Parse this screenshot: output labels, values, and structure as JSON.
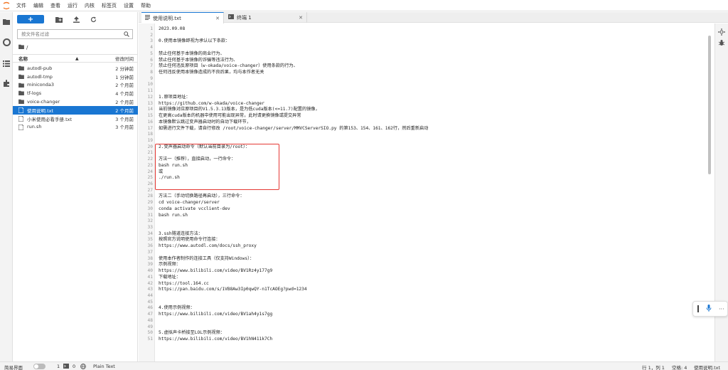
{
  "menu": [
    "文件",
    "编辑",
    "查看",
    "运行",
    "内核",
    "标签页",
    "设置",
    "帮助"
  ],
  "filebrowser": {
    "search_placeholder": "按文件名过滤",
    "breadcrumb": "/",
    "col_name": "名称",
    "col_modified": "修改时间",
    "items": [
      {
        "name": "autodl-pub",
        "time": "2 分钟前",
        "type": "folder"
      },
      {
        "name": "autodl-tmp",
        "time": "1 分钟前",
        "type": "folder"
      },
      {
        "name": "miniconda3",
        "time": "2 个月前",
        "type": "folder"
      },
      {
        "name": "tf-logs",
        "time": "4 个月前",
        "type": "folder"
      },
      {
        "name": "voice-changer",
        "time": "2 个月前",
        "type": "folder"
      },
      {
        "name": "使用说明.txt",
        "time": "2 个月前",
        "type": "file"
      },
      {
        "name": "小米使用必看手册.txt",
        "time": "3 个月前",
        "type": "file"
      },
      {
        "name": "run.sh",
        "time": "3 个月前",
        "type": "file"
      }
    ]
  },
  "tabs": [
    {
      "label": "使用说明.txt",
      "active": true
    },
    {
      "label": "终端 1",
      "active": false
    }
  ],
  "editor_lines": [
    "2023.09.08",
    "",
    "0.使用本镜像即视为承认以下条款：",
    "",
    "禁止任何基于本镜像的商业行为、",
    "禁止任何基于本镜像的诈骗等违法行为、",
    "禁止任何违反原项目（w-okada/voice-changer）使用条款的行为、",
    "任何违反使用本镜像造成的不良后果，均与本作者无关",
    "",
    "",
    "",
    "1.原项目地址：",
    "https://github.com/w-okada/voice-changer",
    "当前镜像对应原项目的V1.5.3.13版本，是为低cuda版本(<=11.7)配置的镜像，",
    "在更高cuda版本的机器中使用可能出现异常，此时请更换镜像或提交异常",
    "本镜像默认跳过变声器启动时的自动下载环节，",
    "如需进行文件下载，请自行修改 /root/voice-changer/server/MMVCServerSIO.py 的第153、154、161、162行，然后重新启动",
    "",
    "",
    "2.变声器启动命令（默认当前目录为/root）：",
    "",
    "方法一（推荐），直接启动，一行命令：",
    "bash run.sh",
    "或",
    "./run.sh",
    "",
    "",
    "方法二（手动切换路径再启动），三行命令：",
    "cd voice-changer/server",
    "conda activate vcclient-dev",
    "bash run.sh",
    "",
    "",
    "3.ssh隧道连接方法：",
    "按照官方说明使用命令行连接：",
    "https://www.autodl.com/docs/ssh_proxy",
    "",
    "使用本作者制作的连接工具（仅支持Windows）：",
    "示例视频：",
    "https://www.bilibili.com/video/BV1Rz4y177g9",
    "下载地址：",
    "https://tool.164.cc",
    "https://pan.baidu.com/s/1VB8Aw3Ip0qwQY-n1TcAOEg?pwd=1234",
    "",
    "",
    "4.使用示例视频：",
    "https://www.bilibili.com/video/BV1ah4y1s7gg",
    "",
    "",
    "5.虚拟声卡桥接至LOL示例视频：",
    "https://www.bilibili.com/video/BV1hN411k7Ch"
  ],
  "statusbar": {
    "simple_mode": "简易界面",
    "count1": "1",
    "count2": "0",
    "mode": "Plain Text",
    "cursor": "行 1，列 1",
    "spaces": "空格: 4",
    "filename": "使用说明.txt"
  },
  "colors": {
    "accent": "#1976d2",
    "highlight_box": "#e53935"
  }
}
